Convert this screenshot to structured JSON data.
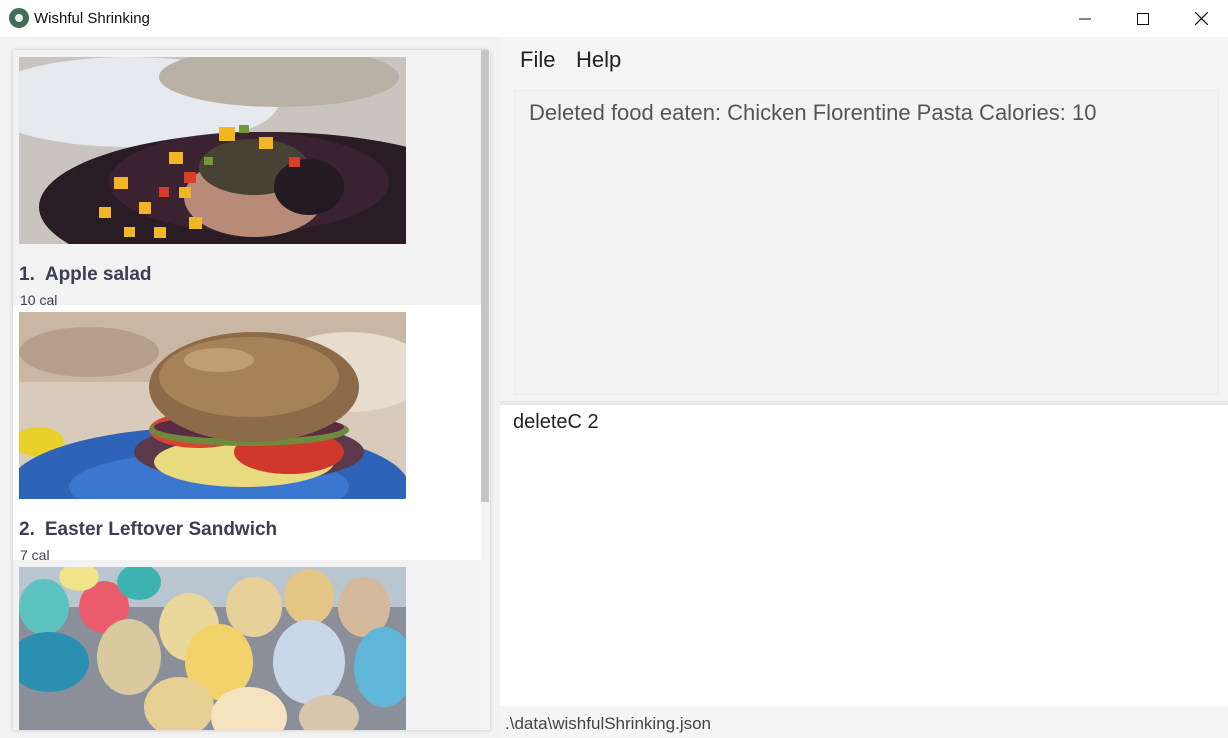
{
  "window": {
    "title": "Wishful Shrinking",
    "controls": [
      "minimize",
      "maximize",
      "close"
    ]
  },
  "menu": {
    "file": "File",
    "help": "Help"
  },
  "result": {
    "message": "Deleted food eaten: Chicken Florentine Pasta Calories: 10"
  },
  "command": {
    "value": "deleteC 2"
  },
  "status": {
    "path": ".\\data\\wishfulShrinking.json"
  },
  "food_list": [
    {
      "index": "1.",
      "name": "Apple salad",
      "calories": "10 cal"
    },
    {
      "index": "2.",
      "name": "Easter Leftover Sandwich",
      "calories": "7 cal"
    },
    {
      "index": "",
      "name": "",
      "calories": ""
    }
  ]
}
